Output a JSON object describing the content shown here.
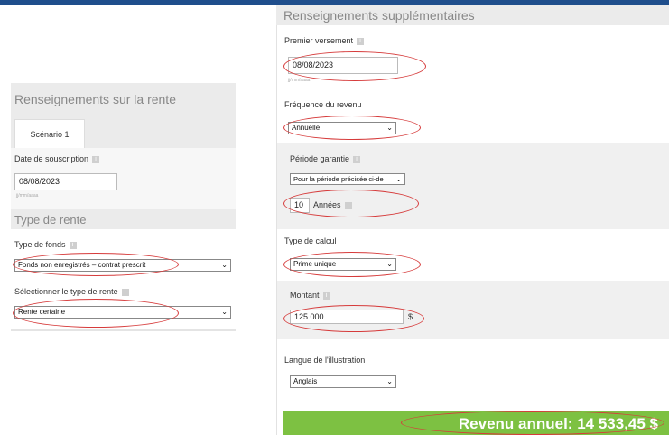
{
  "left": {
    "header": "Renseignements sur la rente",
    "tab_label": "Scénario 1",
    "subscription_label": "Date de souscription",
    "subscription_value": "08/08/2023",
    "date_hint": "jj/mm/aaaa",
    "section_title": "Type de rente",
    "fund_type_label": "Type de fonds",
    "fund_type_value": "Fonds non enregistrés – contrat prescrit",
    "annuity_type_label": "Sélectionner le type de rente",
    "annuity_type_value": "Rente certaine"
  },
  "right": {
    "header": "Renseignements supplémentaires",
    "first_payment_label": "Premier versement",
    "first_payment_value": "08/08/2023",
    "date_hint": "jj/mm/aaaa",
    "frequency_label": "Fréquence du revenu",
    "frequency_value": "Annuelle",
    "guarantee_label": "Période garantie",
    "guarantee_select_value": "Pour la période précisée ci-de",
    "guarantee_years_value": "10",
    "guarantee_years_unit": "Années",
    "calc_type_label": "Type de calcul",
    "calc_type_value": "Prime unique",
    "amount_label": "Montant",
    "amount_value": "125 000",
    "amount_currency": "$",
    "language_label": "Langue de l'illustration",
    "language_value": "Anglais",
    "result_text": "Revenu annuel: 14 533,45 $"
  },
  "icons": {
    "info": "i",
    "chevron": "⌄"
  },
  "colors": {
    "accent_blue": "#1f4e8c",
    "annotation_red": "#d63b3b",
    "result_green": "#7dc142",
    "panel_gray": "#ebebeb"
  }
}
